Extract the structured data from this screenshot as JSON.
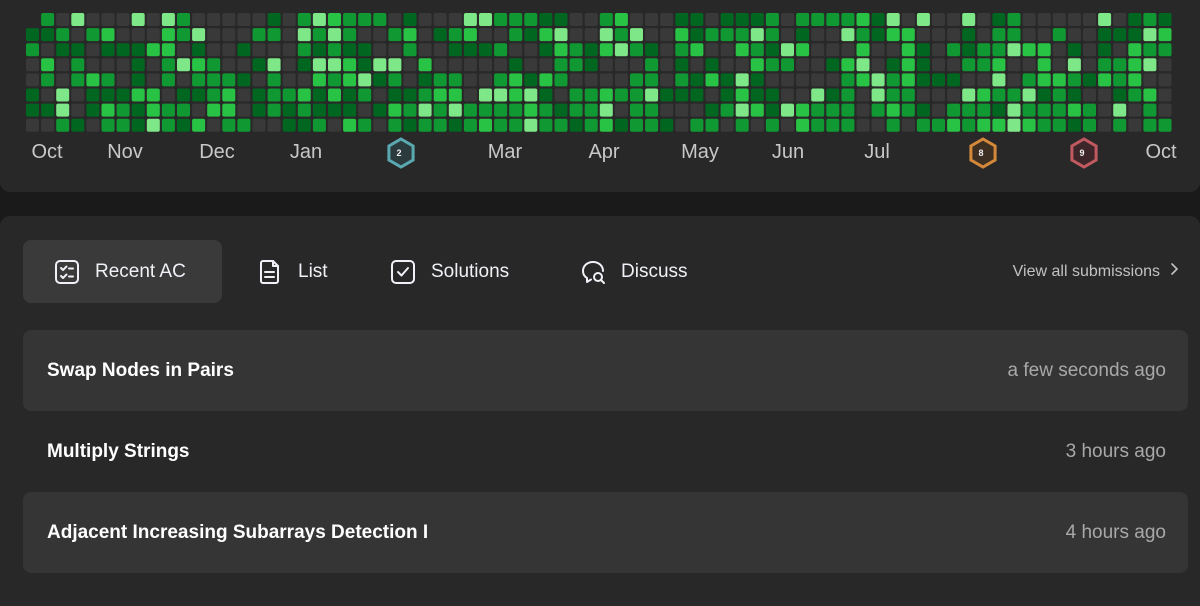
{
  "heatmap": {
    "months": [
      "Oct",
      "Nov",
      "Dec",
      "Jan",
      "Mar",
      "Apr",
      "May",
      "Jun",
      "Jul",
      "Oct"
    ],
    "badges": [
      {
        "icon": "hexagon-badge-icon",
        "number": "2",
        "color": "#5aa8b0"
      },
      {
        "icon": "hexagon-badge-icon",
        "number": "8",
        "color": "#d4883a"
      },
      {
        "icon": "hexagon-badge-icon",
        "number": "9",
        "color": "#c05a60"
      }
    ],
    "colors": {
      "empty": "#393939",
      "levels": [
        "#006620",
        "#109932",
        "#28c244",
        "#7ee787"
      ]
    }
  },
  "tabs": [
    {
      "label": "Recent AC",
      "icon": "checklist-icon",
      "active": true
    },
    {
      "label": "List",
      "icon": "document-icon",
      "active": false
    },
    {
      "label": "Solutions",
      "icon": "checkbox-icon",
      "active": false
    },
    {
      "label": "Discuss",
      "icon": "discuss-search-icon",
      "active": false
    }
  ],
  "view_all": {
    "label": "View all submissions",
    "icon": "chevron-right-icon"
  },
  "submissions": [
    {
      "title": "Swap Nodes in Pairs",
      "time": "a few seconds ago"
    },
    {
      "title": "Multiply Strings",
      "time": "3 hours ago"
    },
    {
      "title": "Adjacent Increasing Subarrays Detection I",
      "time": "4 hours ago"
    }
  ]
}
